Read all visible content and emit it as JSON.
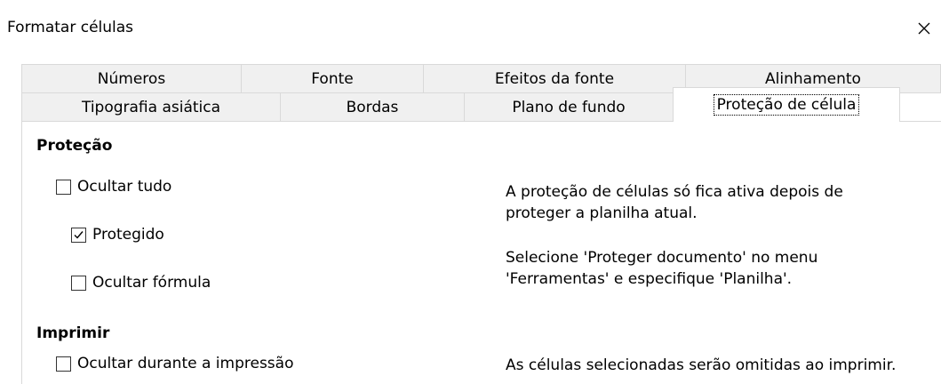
{
  "dialog": {
    "title": "Formatar células"
  },
  "tabs": {
    "row1": [
      "Números",
      "Fonte",
      "Efeitos da fonte",
      "Alinhamento"
    ],
    "row2": [
      "Tipografia asiática",
      "Bordas",
      "Plano de fundo",
      "Proteção de célula"
    ],
    "active": "Proteção de célula"
  },
  "protection": {
    "heading": "Proteção",
    "hide_all": {
      "label": "Ocultar tudo",
      "checked": false
    },
    "protected": {
      "label": "Protegido",
      "checked": true
    },
    "hide_formula": {
      "label": "Ocultar fórmula",
      "checked": false
    },
    "info_line1": "A proteção de células só fica ativa depois de",
    "info_line2": "proteger a planilha atual.",
    "info_line3": "Selecione 'Proteger documento' no menu",
    "info_line4": "'Ferramentas' e especifique 'Planilha'."
  },
  "print": {
    "heading": "Imprimir",
    "hide_when_printing": {
      "label": "Ocultar durante a impressão",
      "checked": false
    },
    "info": "As células selecionadas serão omitidas ao imprimir."
  }
}
